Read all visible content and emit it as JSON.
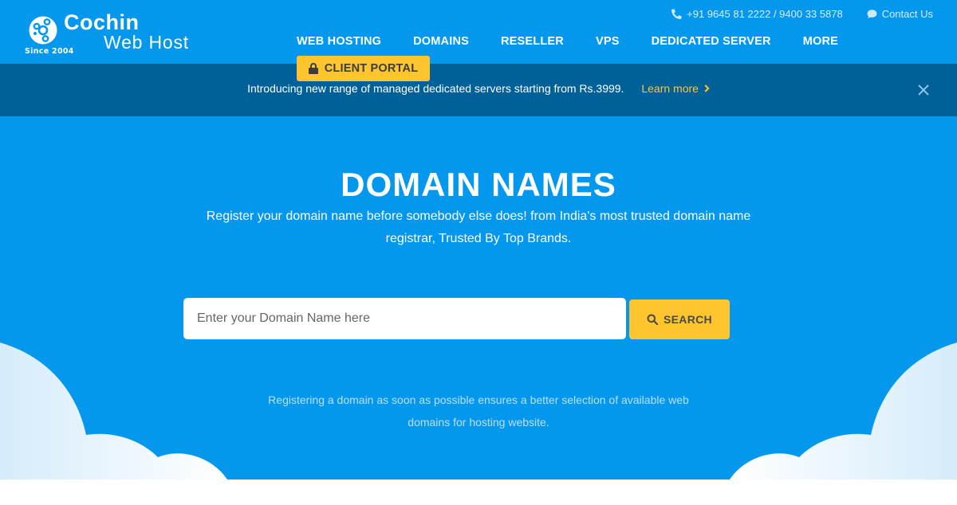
{
  "brand": {
    "name": "Cochin",
    "subname": "Web Host",
    "since": "Since 2004"
  },
  "topbar": {
    "phone": "+91 9645 81 2222 / 9400 33 5878",
    "contact": "Contact Us"
  },
  "nav": {
    "items": [
      {
        "label": "WEB HOSTING"
      },
      {
        "label": "DOMAINS"
      },
      {
        "label": "RESELLER"
      },
      {
        "label": "VPS"
      },
      {
        "label": "DEDICATED SERVER"
      },
      {
        "label": "MORE"
      }
    ],
    "client_portal": "CLIENT PORTAL"
  },
  "banner": {
    "text": "Introducing new range of managed dedicated servers starting from Rs.3999.",
    "link": "Learn more"
  },
  "hero": {
    "title": "DOMAIN NAMES",
    "subtitle": "Register your domain name before somebody else does! from India's most trusted domain name registrar, Trusted By Top Brands.",
    "search_placeholder": "Enter your Domain Name here",
    "search_value": "",
    "search_button": "SEARCH",
    "note": "Registering a domain as soon as possible ensures a better selection of available web domains for hosting website."
  },
  "colors": {
    "primary_blue": "#0398ee",
    "banner_blue": "#006199",
    "accent_yellow": "#fec52e",
    "white": "#ffffff"
  }
}
